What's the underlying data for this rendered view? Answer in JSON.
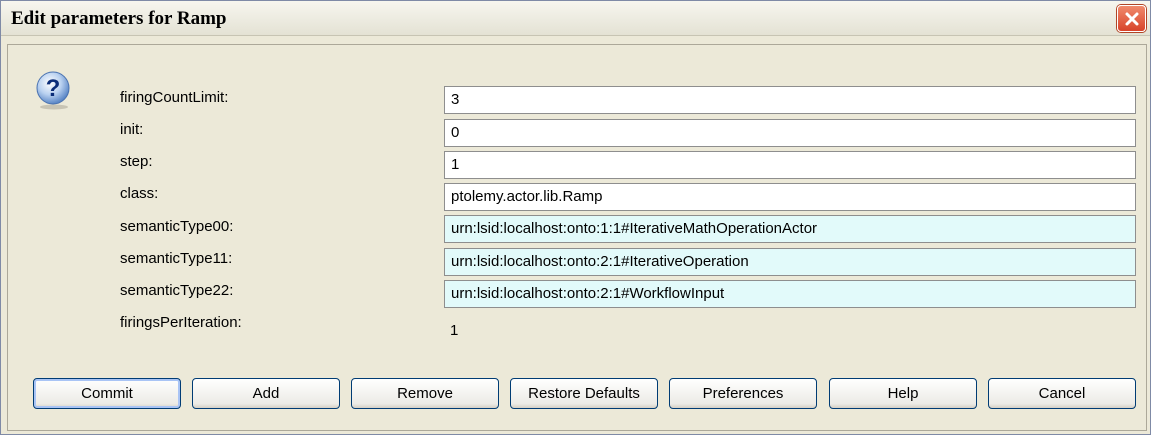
{
  "window": {
    "title": "Edit parameters for Ramp"
  },
  "parameters": [
    {
      "label": "firingCountLimit:",
      "value": "3"
    },
    {
      "label": "init:",
      "value": "0"
    },
    {
      "label": "step:",
      "value": "1"
    },
    {
      "label": "class:",
      "value": "ptolemy.actor.lib.Ramp"
    },
    {
      "label": "semanticType00:",
      "value": "urn:lsid:localhost:onto:1:1#IterativeMathOperationActor"
    },
    {
      "label": "semanticType11:",
      "value": "urn:lsid:localhost:onto:2:1#IterativeOperation"
    },
    {
      "label": "semanticType22:",
      "value": "urn:lsid:localhost:onto:2:1#WorkflowInput"
    },
    {
      "label": "firingsPerIteration:",
      "value": "1"
    }
  ],
  "buttons": {
    "commit": "Commit",
    "add": "Add",
    "remove": "Remove",
    "restore_defaults": "Restore Defaults",
    "preferences": "Preferences",
    "help": "Help",
    "cancel": "Cancel"
  },
  "icons": {
    "dialog": "question-icon",
    "close": "close-icon"
  },
  "colors": {
    "semantic_field_bg": "#e2fafa",
    "close_button": "#d8432a",
    "dialog_bg": "#ece9d8"
  }
}
